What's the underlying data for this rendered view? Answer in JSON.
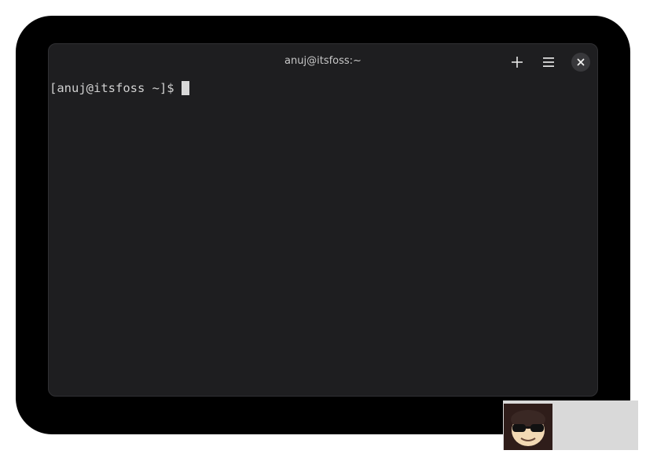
{
  "window": {
    "title": "anuj@itsfoss:~"
  },
  "header": {
    "new_tab_icon": "plus-icon",
    "menu_icon": "hamburger-menu-icon",
    "close_icon": "close-icon"
  },
  "terminal": {
    "prompt": "[anuj@itsfoss ~]$",
    "input": ""
  },
  "watermark": {
    "icon": "tux-sunglasses-logo"
  },
  "colors": {
    "backdrop": "#000000",
    "terminal_bg": "#1e1e20",
    "text": "#d0d0d0",
    "title_text": "#c8c8c8",
    "close_button_bg": "#38383b"
  }
}
